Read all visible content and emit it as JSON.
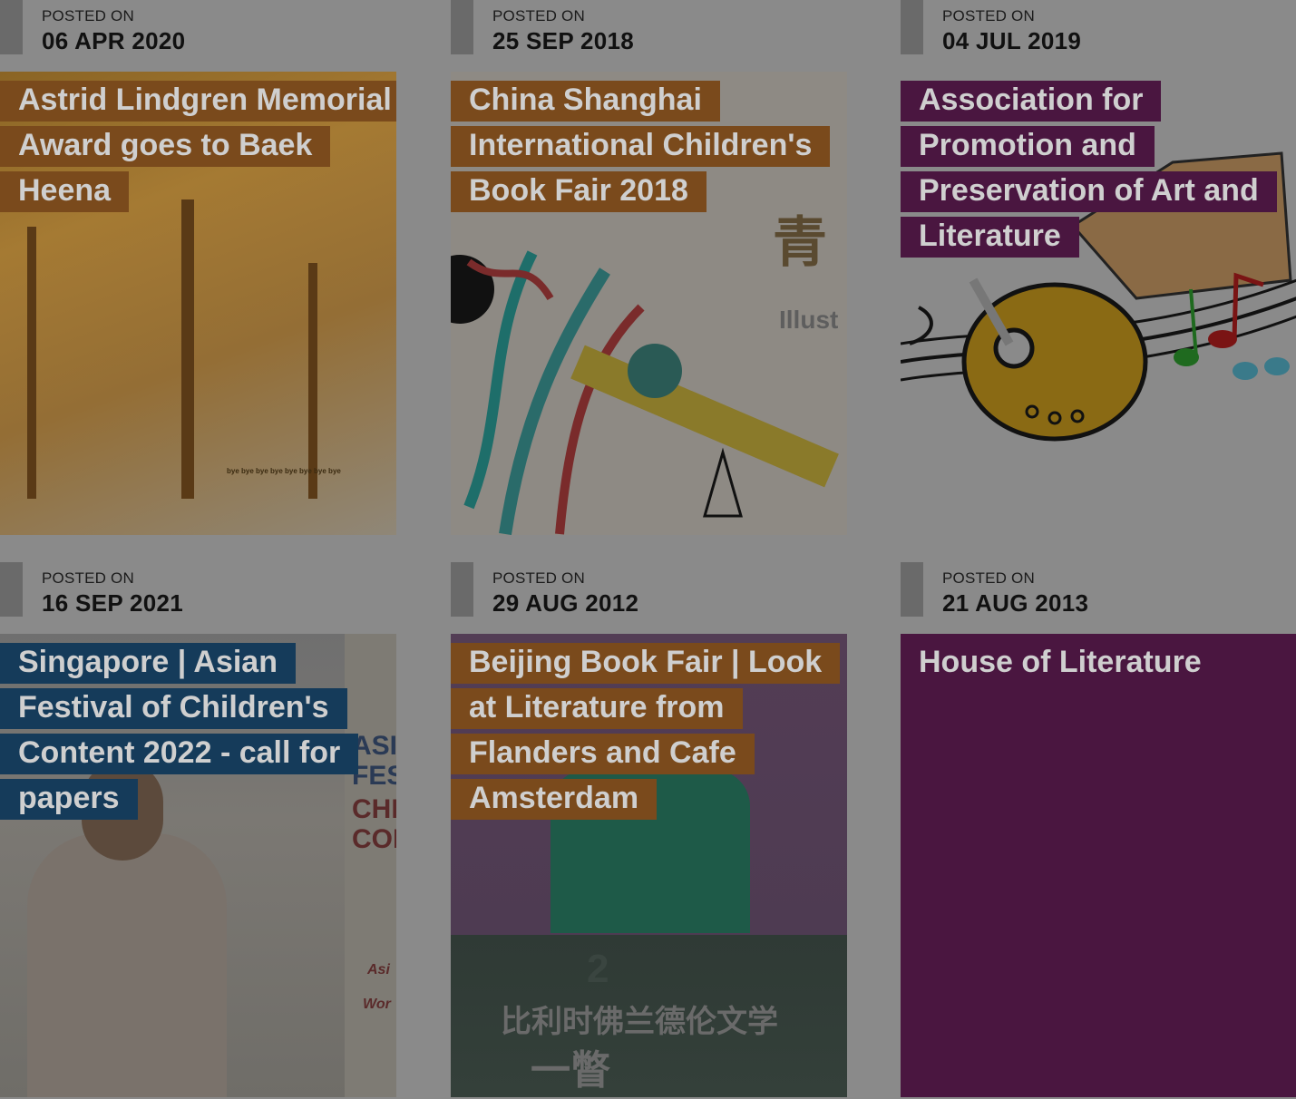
{
  "posted_label": "POSTED ON",
  "posts": [
    {
      "date": "06 APR 2020",
      "title": "Astrid Lindgren Memorial Award goes to Baek Heena",
      "title_color": "#7a4a1c"
    },
    {
      "date": "25 SEP 2018",
      "title": "China Shanghai International Children's Book Fair 2018",
      "title_color": "#7a4a1c"
    },
    {
      "date": "04 JUL 2019",
      "title": "Association for Promotion and Preservation of Art and Literature",
      "title_color": "#4a1640"
    },
    {
      "date": "16 SEP 2021",
      "title": "Singapore | Asian Festival of Children's Content 2022 - call for papers",
      "title_color": "#153b5a"
    },
    {
      "date": "29 AUG 2012",
      "title": "Beijing Book Fair | Look at Literature from Flanders and Cafe Amsterdam",
      "title_color": "#7a4a1c"
    },
    {
      "date": "21 AUG 2013",
      "title": "House of Literature",
      "title_color": "#4a1640"
    }
  ],
  "image_text": {
    "autumn_caption": "bye bye bye bye bye bye bye bye",
    "shanghai_chars": "青",
    "shanghai_word": "Illust",
    "singapore_sign": [
      "ASI",
      "FES",
      "CHI",
      "CON"
    ],
    "singapore_small": [
      "Asi",
      "Wor"
    ],
    "beijing_number": "2",
    "beijing_chinese": "比利时佛兰德伦文学",
    "beijing_chinese2": "一瞥"
  }
}
